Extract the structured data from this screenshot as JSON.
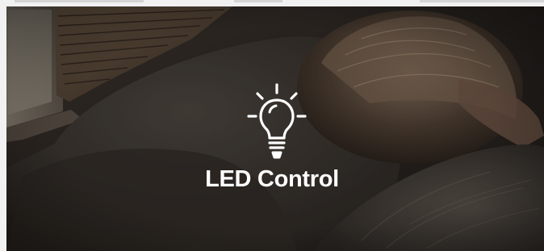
{
  "hero": {
    "title": "LED Control",
    "icon": "lightbulb-icon",
    "background_description_color": "#2a2420",
    "text_color": "#ffffff"
  }
}
